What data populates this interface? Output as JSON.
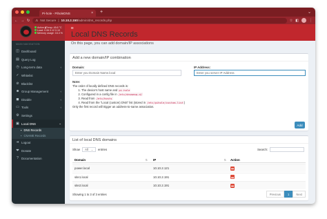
{
  "browser": {
    "tab_title": "Pi-hole - PiholeDNS",
    "not_secure": "Not Secure",
    "url_host": "10.10.2.150",
    "url_path": "/admin/dns_records.php",
    "colors": {
      "tabbar": "#7a1d22",
      "toolbar": "#96262d"
    }
  },
  "sidebar": {
    "status_lines": [
      "Active",
      "Temp: 45.6 °C",
      "Load: 0.06 0.12 0.10",
      "Memory usage: 16.4 %"
    ],
    "nav_header": "MAIN NAVIGATION",
    "items": [
      {
        "label": "Dashboard",
        "icon": "dashboard-icon",
        "glyph": "◫"
      },
      {
        "label": "Query Log",
        "icon": "file-icon",
        "glyph": "▤"
      },
      {
        "label": "Long-term data",
        "icon": "history-icon",
        "glyph": "◷",
        "caret": "‹"
      },
      {
        "label": "Whitelist",
        "icon": "check-circle-icon",
        "glyph": "✓"
      },
      {
        "label": "Blacklist",
        "icon": "ban-icon",
        "glyph": "⊘"
      },
      {
        "label": "Group Management",
        "icon": "users-icon",
        "glyph": "☻",
        "caret": "‹"
      },
      {
        "label": "Disable",
        "icon": "stop-icon",
        "glyph": "◼",
        "caret": "‹"
      },
      {
        "label": "Tools",
        "icon": "folder-icon",
        "glyph": "▭",
        "caret": "‹"
      },
      {
        "label": "Settings",
        "icon": "gear-icon",
        "glyph": "⚙"
      },
      {
        "label": "Local DNS",
        "icon": "address-book-icon",
        "glyph": "▣",
        "caret": "⌄"
      }
    ],
    "sub_items": [
      {
        "label": "DNS Records",
        "glyph": "▪"
      },
      {
        "label": "CNAME Records",
        "glyph": "▪"
      }
    ],
    "bottom_items": [
      {
        "label": "Logout",
        "icon": "logout-icon",
        "glyph": "➜"
      },
      {
        "label": "Donate",
        "icon": "paypal-icon",
        "glyph": "❤"
      },
      {
        "label": "Documentation",
        "icon": "question-circle-icon",
        "glyph": "?"
      }
    ]
  },
  "page": {
    "title": "Local DNS Records",
    "subtitle": "On this page, you can add domain/IP associations"
  },
  "add_box": {
    "title": "Add a new domain/IP combination",
    "domain_label": "Domain:",
    "domain_placeholder": "Enter you Domain Name.local",
    "ip_label": "IP Address:",
    "ip_placeholder": "Enter you server IP Address",
    "note_title": "Note:",
    "note_intro": "The order of locally defined DNS records is:",
    "note_items": [
      {
        "pre": "The device's host name and ",
        "code": "pi.hole",
        "post": ""
      },
      {
        "pre": "Configured in a config file in ",
        "code": "/etc/dnsmasq.d/",
        "post": ""
      },
      {
        "pre": "Read from ",
        "code": "/etc/hosts",
        "post": ""
      },
      {
        "pre": "Read from the \"Local (custom) DNS\" list (stored in ",
        "code": "/etc/pihole/custom.list",
        "post": ")"
      }
    ],
    "note_footer": "Only the first record will trigger an address-to-name association.",
    "add_button": "Add"
  },
  "list_box": {
    "title": "List of local DNS domains",
    "show_label": "Show",
    "show_value": "All",
    "entries_label": "entries",
    "search_label": "Search:",
    "columns": [
      "Domain",
      "IP",
      "Action"
    ],
    "rows": [
      {
        "domain": "power.local",
        "ip": "10.10.2.121"
      },
      {
        "domain": "site1.local",
        "ip": "10.10.2.191"
      },
      {
        "domain": "site2.local",
        "ip": "10.10.2.191"
      }
    ],
    "info": "Showing 1 to 3 of 3 entries",
    "pager": {
      "previous": "Previous",
      "current": "1",
      "next": "Next"
    }
  }
}
